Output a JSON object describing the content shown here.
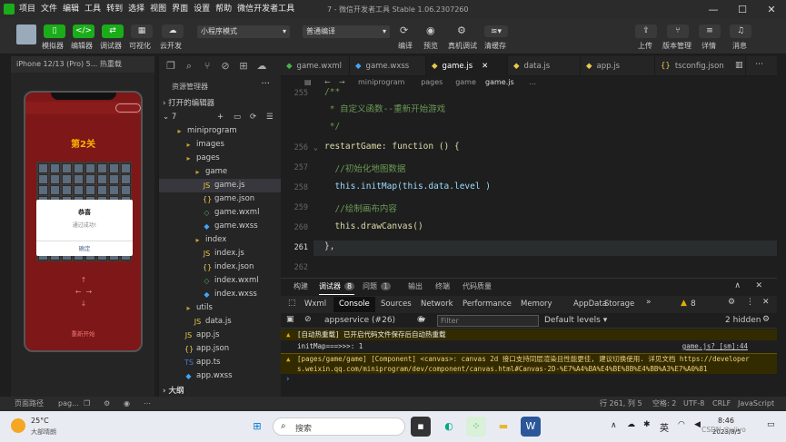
{
  "app": {
    "title": "7 - 微信开发者工具 Stable 1.06.2307260"
  },
  "menu": [
    "项目",
    "文件",
    "编辑",
    "工具",
    "转到",
    "选择",
    "视图",
    "界面",
    "设置",
    "帮助",
    "微信开发者工具"
  ],
  "toolbar": {
    "simulator": "模拟器",
    "editor": "编辑器",
    "debugger": "调试器",
    "visual": "可视化",
    "cloud": "云开发",
    "mode": "小程序模式",
    "compile": "普通编译",
    "compile_btn": "编译",
    "preview": "预览",
    "realdebug": "真机调试",
    "clearcache": "清缓存",
    "upload": "上传",
    "version": "版本管理",
    "details": "详情",
    "messages": "消息"
  },
  "simulator": {
    "device": "iPhone 12/13 (Pro) 5...",
    "hotreload": "热重载",
    "level": "第2关",
    "dialog_title": "恭喜",
    "dialog_text": "通过成功!",
    "dialog_btn": "确定",
    "restart": "重新开始"
  },
  "explorer": {
    "title": "资源管理器",
    "open_editors": "打开的编辑器",
    "project": "7",
    "outline": "大纲",
    "items": [
      {
        "label": "miniprogram",
        "depth": 1,
        "type": "folder"
      },
      {
        "label": "images",
        "depth": 2,
        "type": "folder"
      },
      {
        "label": "pages",
        "depth": 2,
        "type": "folder"
      },
      {
        "label": "game",
        "depth": 3,
        "type": "folder"
      },
      {
        "label": "game.js",
        "depth": 4,
        "type": "js"
      },
      {
        "label": "game.json",
        "depth": 4,
        "type": "json"
      },
      {
        "label": "game.wxml",
        "depth": 4,
        "type": "wxml"
      },
      {
        "label": "game.wxss",
        "depth": 4,
        "type": "wxss"
      },
      {
        "label": "index",
        "depth": 3,
        "type": "folder"
      },
      {
        "label": "index.js",
        "depth": 4,
        "type": "js"
      },
      {
        "label": "index.json",
        "depth": 4,
        "type": "json"
      },
      {
        "label": "index.wxml",
        "depth": 4,
        "type": "wxml"
      },
      {
        "label": "index.wxss",
        "depth": 4,
        "type": "wxss"
      },
      {
        "label": "utils",
        "depth": 2,
        "type": "folder"
      },
      {
        "label": "data.js",
        "depth": 3,
        "type": "js"
      },
      {
        "label": "app.js",
        "depth": 2,
        "type": "js"
      },
      {
        "label": "app.json",
        "depth": 2,
        "type": "json"
      },
      {
        "label": "app.ts",
        "depth": 2,
        "type": "ts"
      },
      {
        "label": "app.wxss",
        "depth": 2,
        "type": "wxss"
      }
    ]
  },
  "tabs": [
    "game.wxml",
    "game.wxss",
    "game.js",
    "data.js",
    "app.js",
    "tsconfig.json"
  ],
  "breadcrumb": [
    "miniprogram",
    "pages",
    "game",
    "game.js",
    "..."
  ],
  "code": {
    "lines": [
      {
        "no": "255",
        "text": "/**",
        "color": "#6a9955"
      },
      {
        "no": "",
        "text": " * 自定义函数--重新开始游戏",
        "color": "#6a9955"
      },
      {
        "no": "",
        "text": " */",
        "color": "#6a9955"
      },
      {
        "no": "256",
        "text": "restartGame: function () {",
        "color": "#dcdcaa"
      },
      {
        "no": "257",
        "text": "  //初始化地图数据",
        "color": "#6a9955"
      },
      {
        "no": "258",
        "text": "  this.initMap(this.data.level )",
        "color": "#9cdcfe"
      },
      {
        "no": "259",
        "text": "  //绘制画布内容",
        "color": "#6a9955"
      },
      {
        "no": "260",
        "text": "  this.drawCanvas()",
        "color": "#dcdcaa"
      },
      {
        "no": "261",
        "text": "},",
        "color": "#d4d4d4"
      },
      {
        "no": "262",
        "text": "",
        "color": "#d4d4d4"
      }
    ]
  },
  "panel": {
    "tabs": [
      "构建",
      "调试器",
      "问题",
      "输出",
      "终端",
      "代码质量"
    ],
    "debugger_count": "8",
    "problems_count": "1",
    "devtools": [
      "Wxml",
      "Console",
      "Sources",
      "Network",
      "Performance",
      "Memory",
      "AppData",
      "Storage"
    ],
    "warn_count": "8",
    "context": "appservice (#26)",
    "filter": "Filter",
    "levels": "Default levels",
    "hidden": "2 hidden",
    "log1": "[自动热重载] 已开启代码文件保存后自动热重载",
    "log2": "initMap===>>>: 1",
    "log2_src": "game.js? [sm]:44",
    "log3": "[pages/game/game] [Component] <canvas>: canvas 2d 接口支持同层渲染且性能更佳, 建议切换使用. 详见文档 https://developers.weixin.qq.com/miniprogram/dev/component/canvas.html#Canvas-2D-%E7%A4%BA%E4%BE%8B%E4%BB%A3%E7%A0%81"
  },
  "status": {
    "left": "页面路径",
    "path": "pag...",
    "pos": "行 261, 列 5",
    "spaces": "空格: 2",
    "enc": "UTF-8",
    "eol": "CRLF",
    "lang": "JavaScript"
  },
  "taskbar": {
    "weather": "25°C",
    "weather2": "大部晴朗",
    "search": "搜索",
    "ime": "英",
    "time": "8:46",
    "date": "2023/8/5",
    "csdn": "CSDN @yiiyo"
  }
}
